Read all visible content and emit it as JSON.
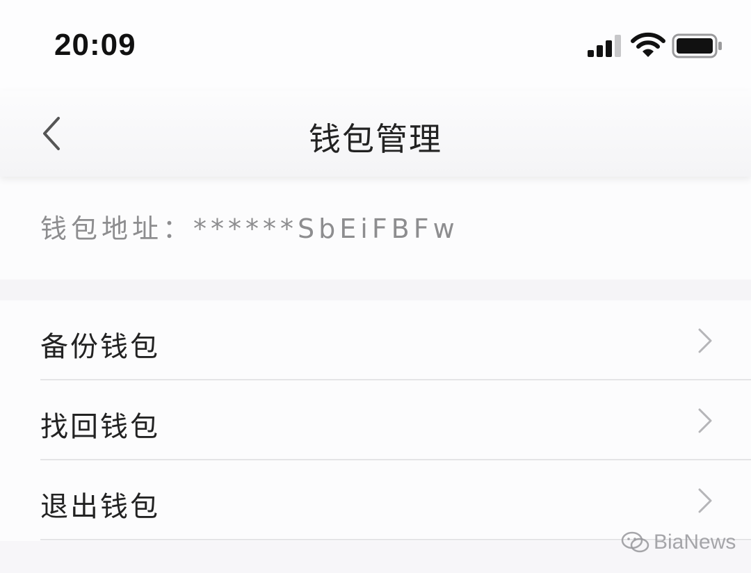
{
  "status_bar": {
    "time": "20:09",
    "icons": [
      "signal-icon",
      "wifi-icon",
      "battery-icon"
    ]
  },
  "nav": {
    "title": "钱包管理",
    "back_icon": "chevron-left-icon"
  },
  "wallet": {
    "address_label": "钱包地址：",
    "address_value": "******SbEiFBFw"
  },
  "menu": {
    "items": [
      {
        "label": "备份钱包",
        "icon": "chevron-right-icon"
      },
      {
        "label": "找回钱包",
        "icon": "chevron-right-icon"
      },
      {
        "label": "退出钱包",
        "icon": "chevron-right-icon"
      }
    ]
  },
  "watermark": {
    "text": "BiaNews",
    "icon": "wechat-icon"
  },
  "colors": {
    "background": "#f7f6f9",
    "title_text": "#222222",
    "secondary_text": "#8d8d8f",
    "chevron": "#b5b5b8"
  }
}
